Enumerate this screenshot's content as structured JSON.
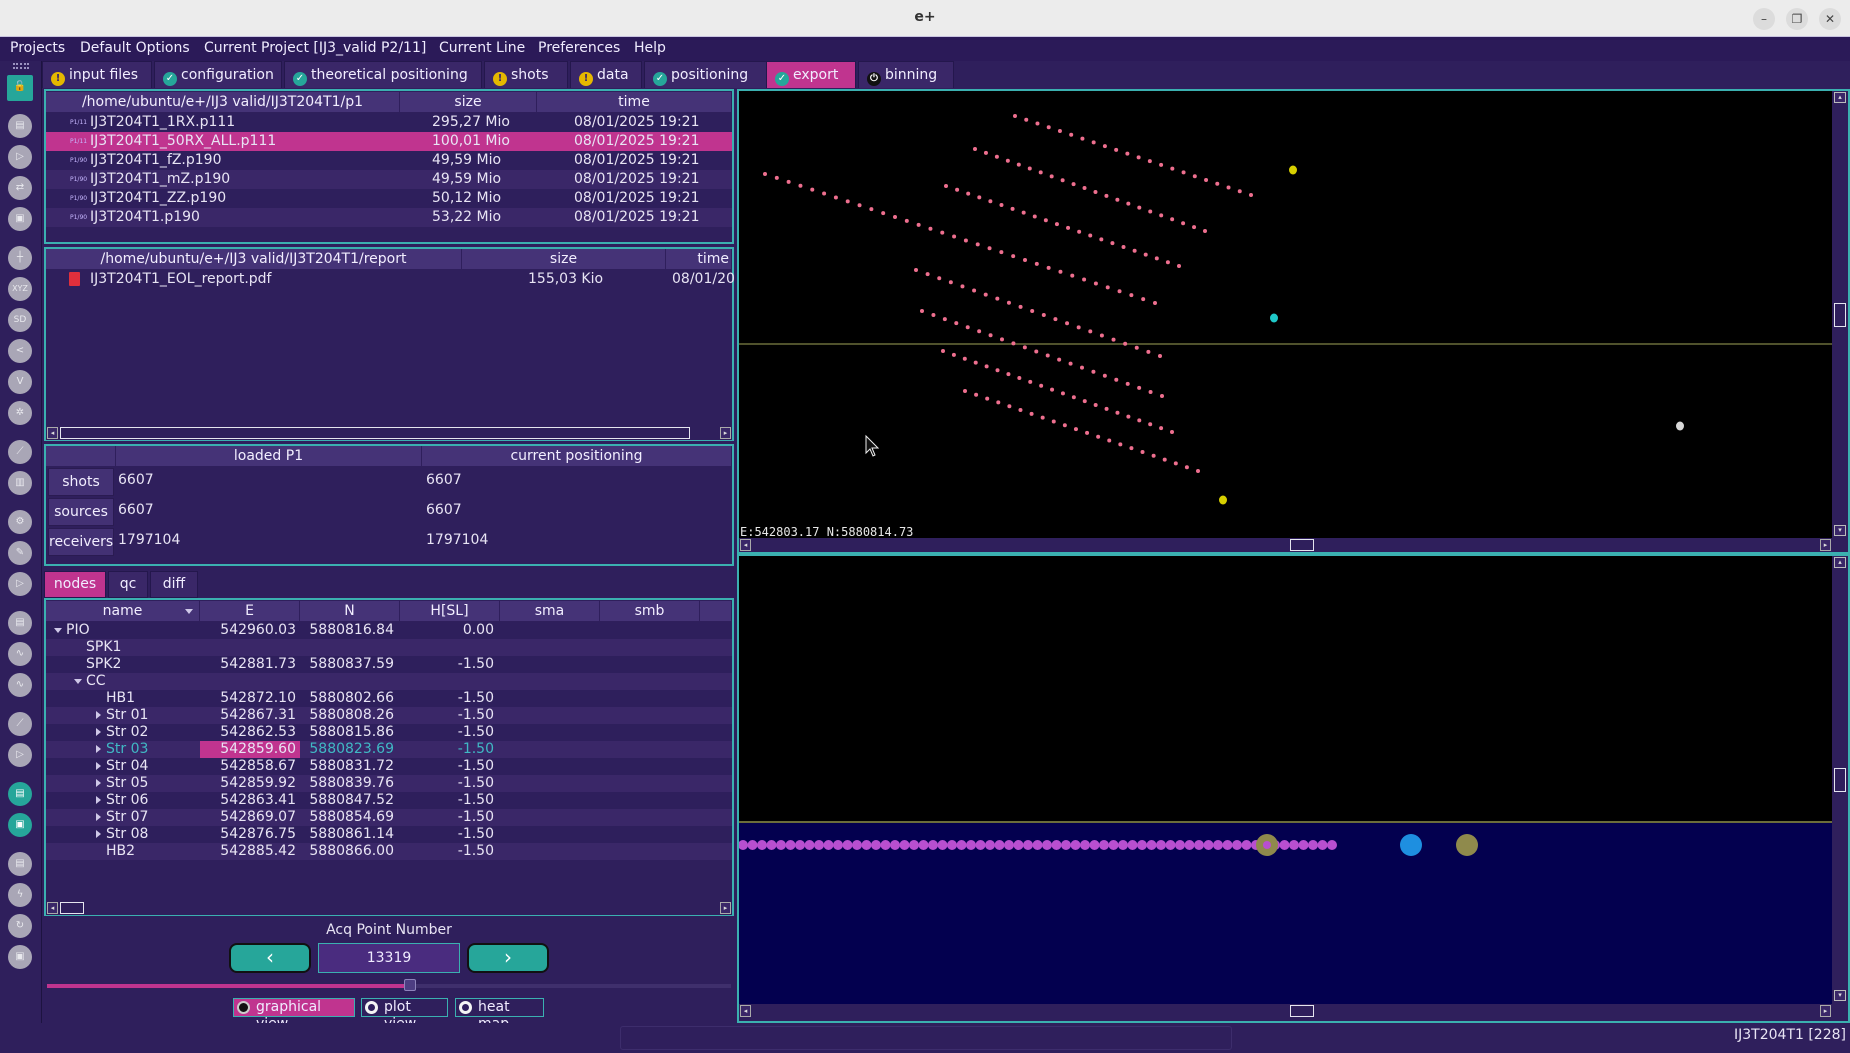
{
  "window": {
    "title": "e+",
    "minimize": "–",
    "restore": "❐",
    "close": "✕"
  },
  "menu": [
    "Projects",
    "Default Options",
    "Current Project [IJ3_valid P2/11]",
    "Current Line",
    "Preferences",
    "Help"
  ],
  "tabs": [
    {
      "label": "input files",
      "status": "warn"
    },
    {
      "label": "configuration",
      "status": "ok"
    },
    {
      "label": "theoretical positioning",
      "status": "ok"
    },
    {
      "label": "shots",
      "status": "warn"
    },
    {
      "label": "data",
      "status": "warn"
    },
    {
      "label": "positioning",
      "status": "ok"
    },
    {
      "label": "export",
      "status": "ok",
      "active": true
    },
    {
      "label": "binning",
      "status": "power"
    }
  ],
  "sidebar_icons": [
    "lock-open-icon",
    "document-icon",
    "play-icon",
    "swap-icon",
    "save-icon",
    "grid-icon",
    "xyz-icon",
    "sd-icon",
    "share-icon",
    "network-icon",
    "cursor-select-icon",
    "measure-icon",
    "map-icon",
    "gear-icon",
    "brush-icon",
    "video-icon",
    "document-icon",
    "waveform-icon",
    "waveform-faded-icon",
    "measure-icon",
    "video-icon",
    "document-teal-icon",
    "save-teal-icon",
    "document-icon",
    "lightning-icon",
    "refresh-icon",
    "save-icon"
  ],
  "p1_files": {
    "headers": [
      "/home/ubuntu/e+/IJ3  valid/IJ3T204T1/p1",
      "size",
      "time"
    ],
    "rows": [
      {
        "icon": "P1/11",
        "name": "IJ3T204T1_1RX.p111",
        "size": "295,27 Mio",
        "time": "08/01/2025 19:21"
      },
      {
        "icon": "P1/11",
        "name": "IJ3T204T1_50RX_ALL.p111",
        "size": "100,01 Mio",
        "time": "08/01/2025 19:21",
        "selected": true
      },
      {
        "icon": "P1/90",
        "name": "IJ3T204T1_fZ.p190",
        "size": "49,59 Mio",
        "time": "08/01/2025 19:21"
      },
      {
        "icon": "P1/90",
        "name": "IJ3T204T1_mZ.p190",
        "size": "49,59 Mio",
        "time": "08/01/2025 19:21"
      },
      {
        "icon": "P1/90",
        "name": "IJ3T204T1_ZZ.p190",
        "size": "50,12 Mio",
        "time": "08/01/2025 19:21"
      },
      {
        "icon": "P1/90",
        "name": "IJ3T204T1.p190",
        "size": "53,22 Mio",
        "time": "08/01/2025 19:21"
      }
    ]
  },
  "report_files": {
    "headers": [
      "/home/ubuntu/e+/IJ3  valid/IJ3T204T1/report",
      "size",
      "time"
    ],
    "rows": [
      {
        "name": "IJ3T204T1_EOL_report.pdf",
        "size": "155,03 Kio",
        "time": "08/01/20"
      }
    ]
  },
  "stats": {
    "headers": [
      "loaded P1",
      "current positioning"
    ],
    "rows": [
      {
        "label": "shots",
        "loaded": "6607",
        "current": "6607"
      },
      {
        "label": "sources",
        "loaded": "6607",
        "current": "6607"
      },
      {
        "label": "receivers",
        "loaded": "1797104",
        "current": "1797104"
      }
    ]
  },
  "subtabs": [
    {
      "label": "nodes",
      "active": true
    },
    {
      "label": "qc"
    },
    {
      "label": "diff"
    }
  ],
  "nodes": {
    "headers": [
      "name",
      "E",
      "N",
      "H[SL]",
      "sma",
      "smb"
    ],
    "rows": [
      {
        "name": "PIO",
        "level": 0,
        "expander": "down",
        "E": "542960.03",
        "N": "5880816.84",
        "H": "0.00"
      },
      {
        "name": "SPK1",
        "level": 1,
        "expander": "",
        "E": "",
        "N": "",
        "H": ""
      },
      {
        "name": "SPK2",
        "level": 1,
        "expander": "",
        "E": "542881.73",
        "N": "5880837.59",
        "H": "-1.50"
      },
      {
        "name": "CC",
        "level": 1,
        "expander": "down",
        "E": "",
        "N": "",
        "H": ""
      },
      {
        "name": "HB1",
        "level": 2,
        "expander": "",
        "E": "542872.10",
        "N": "5880802.66",
        "H": "-1.50"
      },
      {
        "name": "Str 01",
        "level": 2,
        "expander": "right",
        "E": "542867.31",
        "N": "5880808.26",
        "H": "-1.50"
      },
      {
        "name": "Str 02",
        "level": 2,
        "expander": "right",
        "E": "542862.53",
        "N": "5880815.86",
        "H": "-1.50"
      },
      {
        "name": "Str 03",
        "level": 2,
        "expander": "right",
        "E": "542859.60",
        "N": "5880823.69",
        "H": "-1.50",
        "selected": true
      },
      {
        "name": "Str 04",
        "level": 2,
        "expander": "right",
        "E": "542858.67",
        "N": "5880831.72",
        "H": "-1.50"
      },
      {
        "name": "Str 05",
        "level": 2,
        "expander": "right",
        "E": "542859.92",
        "N": "5880839.76",
        "H": "-1.50"
      },
      {
        "name": "Str 06",
        "level": 2,
        "expander": "right",
        "E": "542863.41",
        "N": "5880847.52",
        "H": "-1.50"
      },
      {
        "name": "Str 07",
        "level": 2,
        "expander": "right",
        "E": "542869.07",
        "N": "5880854.69",
        "H": "-1.50"
      },
      {
        "name": "Str 08",
        "level": 2,
        "expander": "right",
        "E": "542876.75",
        "N": "5880861.14",
        "H": "-1.50"
      },
      {
        "name": "HB2",
        "level": 2,
        "expander": "",
        "E": "542885.42",
        "N": "5880866.00",
        "H": "-1.50"
      }
    ]
  },
  "acq": {
    "label": "Acq Point Number",
    "value": "13319",
    "prev": "‹",
    "next": "›",
    "slider_fraction": 0.53
  },
  "view_modes": [
    {
      "label": "graphical view",
      "active": true
    },
    {
      "label": "plot view"
    },
    {
      "label": "heat map"
    }
  ],
  "map_view": {
    "coord_readout": "E:542803.17 N:5880814.73",
    "colors": {
      "receivers": "#ee6f8f",
      "marker_yellow": "#d8d000",
      "marker_cyan": "#1fc8c8",
      "marker_white": "#d8d8d8",
      "horizon": "#6b6d3a"
    }
  },
  "profile_view": {
    "colors": {
      "water": "#03004f",
      "receivers": "#b84fd0",
      "marker_olive": "#8f8a4c",
      "marker_blue": "#1e8fe0"
    }
  },
  "status": {
    "right": "IJ3T204T1 [228]"
  }
}
